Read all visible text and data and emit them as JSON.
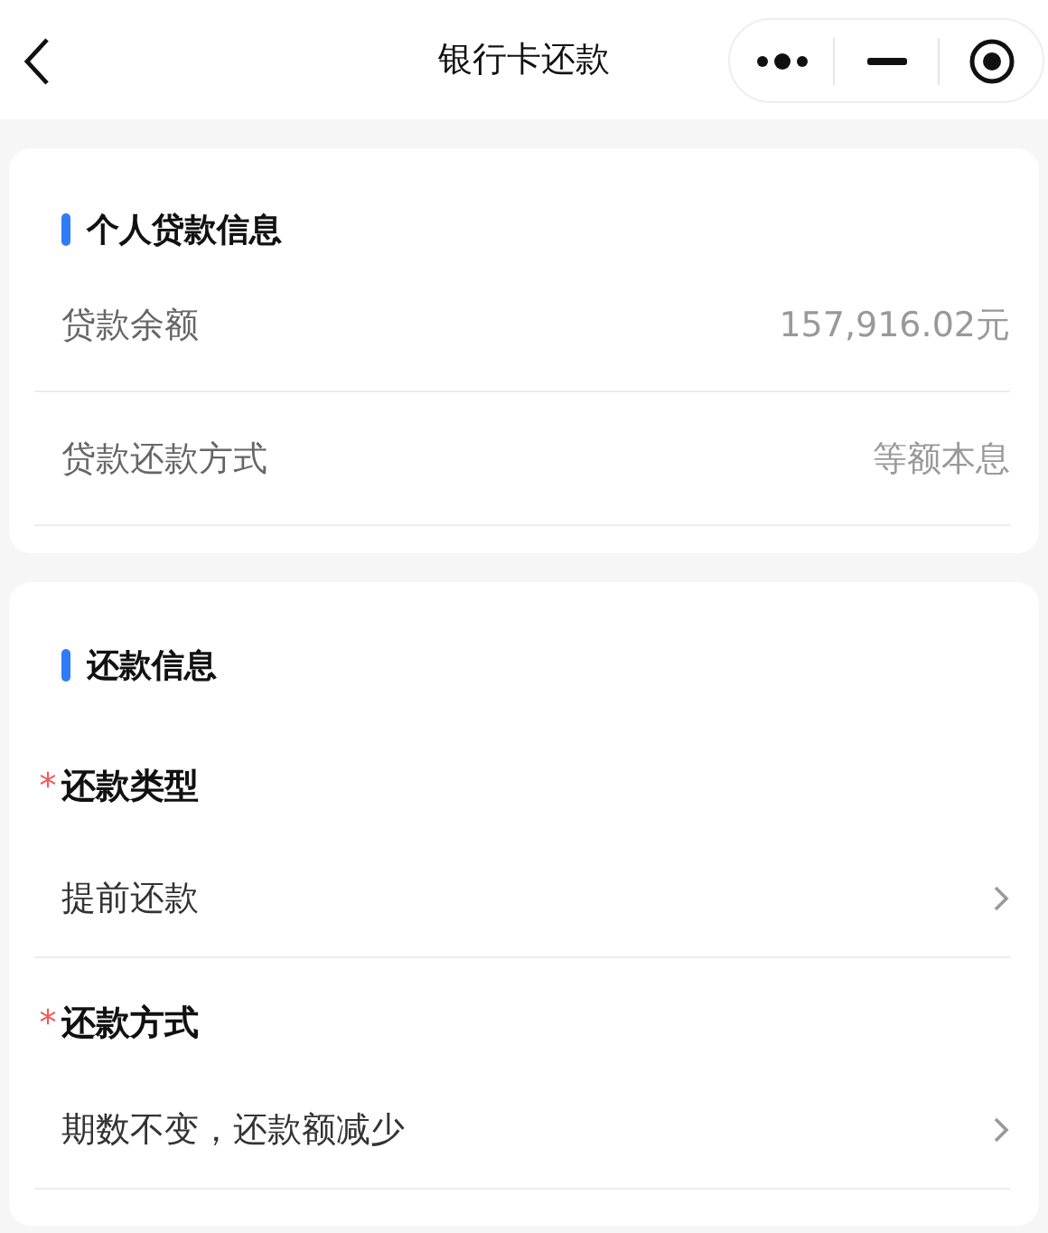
{
  "header": {
    "title": "银行卡还款"
  },
  "loan_info": {
    "title": "个人贷款信息",
    "rows": [
      {
        "label": "贷款余额",
        "value": "157,916.02元"
      },
      {
        "label": "贷款还款方式",
        "value": "等额本息"
      }
    ]
  },
  "repayment": {
    "title": "还款信息",
    "fields": [
      {
        "label": "还款类型",
        "mark": "*",
        "value": "提前还款"
      },
      {
        "label": "还款方式",
        "mark": "*",
        "value": "期数不变，还款额减少"
      }
    ]
  }
}
